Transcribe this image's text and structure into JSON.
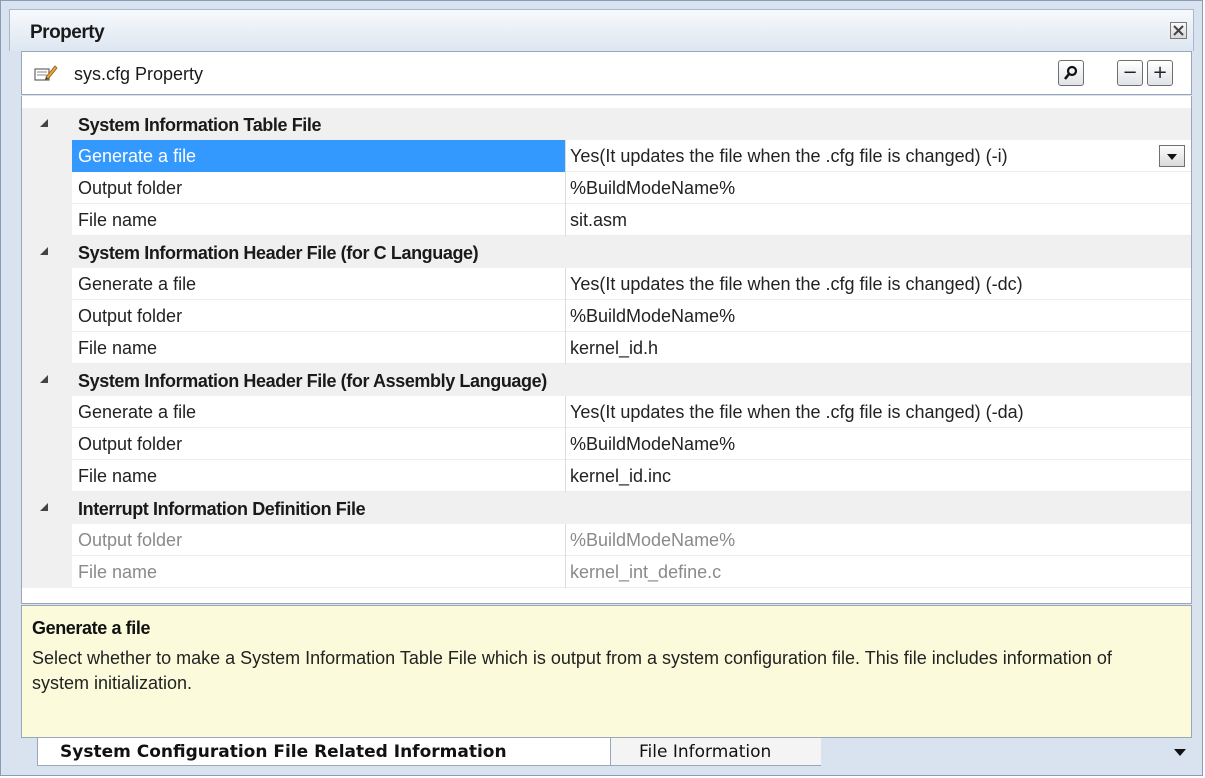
{
  "panel": {
    "title": "Property"
  },
  "toolbar": {
    "label": "sys.cfg Property",
    "collapse_symbol": "−",
    "expand_symbol": "+"
  },
  "categories": [
    {
      "label": "System Information Table File",
      "items": [
        {
          "name": "Generate a file",
          "value": "Yes(It updates the file when the .cfg file is changed) (-i)"
        },
        {
          "name": "Output folder",
          "value": "%BuildModeName%"
        },
        {
          "name": "File name",
          "value": "sit.asm"
        }
      ]
    },
    {
      "label": "System Information Header File (for C Language)",
      "items": [
        {
          "name": "Generate a file",
          "value": "Yes(It updates the file when the .cfg file is changed) (-dc)"
        },
        {
          "name": "Output folder",
          "value": "%BuildModeName%"
        },
        {
          "name": "File name",
          "value": "kernel_id.h"
        }
      ]
    },
    {
      "label": "System Information Header File (for Assembly Language)",
      "items": [
        {
          "name": "Generate a file",
          "value": "Yes(It updates the file when the .cfg file is changed) (-da)"
        },
        {
          "name": "Output folder",
          "value": "%BuildModeName%"
        },
        {
          "name": "File name",
          "value": "kernel_id.inc"
        }
      ]
    },
    {
      "label": "Interrupt Information Definition File",
      "items": [
        {
          "name": "Output folder",
          "value": "%BuildModeName%"
        },
        {
          "name": "File name",
          "value": "kernel_int_define.c"
        }
      ]
    }
  ],
  "description": {
    "title": "Generate a file",
    "text": "Select whether to make a System Information Table File which is output from a system configuration file. This file includes information of system initialization."
  },
  "tabs": [
    {
      "label": "System Configuration File Related Information"
    },
    {
      "label": "File Information"
    }
  ],
  "colors": {
    "selection": "#3399ff",
    "description_bg": "#fbfbdc",
    "category_bg": "#f0f0f0",
    "disabled_text": "#8a8a8a"
  }
}
